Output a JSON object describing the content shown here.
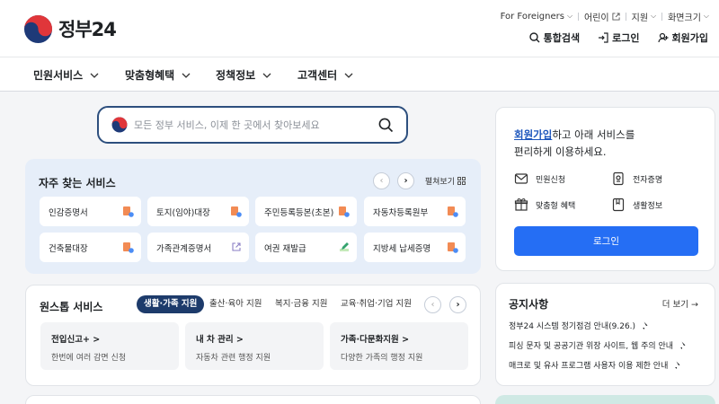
{
  "header": {
    "logo_text": "정부24",
    "util_links": [
      "For Foreigners",
      "어린이",
      "지원",
      "화면크기"
    ],
    "actions": [
      "통합검색",
      "로그인",
      "회원가입"
    ]
  },
  "gnb": [
    "민원서비스",
    "맞춤형혜택",
    "정책정보",
    "고객센터"
  ],
  "search": {
    "placeholder": "모든 정부 서비스, 이제 한 곳에서 찾아보세요"
  },
  "frequent": {
    "title": "자주 찾는 서비스",
    "more_label": "펼쳐보기",
    "items": [
      "인감증명서",
      "토지(임야)대장",
      "주민등록등본(초본)",
      "자동차등록원부",
      "건축물대장",
      "가족관계증명서",
      "여권 재발급",
      "지방세 납세증명"
    ]
  },
  "onestop": {
    "title": "원스톱 서비스",
    "tabs": [
      "생활·가족 지원",
      "출산·육아 지원",
      "복지·금융 지원",
      "교육·취업·기업 지원"
    ],
    "cards": [
      {
        "title": "전입신고+ >",
        "desc": "한번에 여러 감면 신청"
      },
      {
        "title": "내 차 관리 >",
        "desc": "자동차 관련 행정 지원"
      },
      {
        "title": "가족·다문화지원 >",
        "desc": "다양한 가족의 행정 지원"
      }
    ]
  },
  "login_panel": {
    "link": "회원가입",
    "msg_rest": "하고 아래 서비스를",
    "msg_line2": "편리하게 이용하세요.",
    "services": [
      "민원신청",
      "전자증명",
      "맞춤형 혜택",
      "생활정보"
    ],
    "button": "로그인"
  },
  "notice": {
    "title": "공지사항",
    "more": "더 보기 →",
    "items": [
      "정부24 시스템 정기점검 안내(9.26.)",
      "피싱 문자 및 공공기관 위장 사이트, 웹 주의 안내",
      "매크로 및 유사 프로그램 사용자 이용 제한 안내"
    ]
  }
}
